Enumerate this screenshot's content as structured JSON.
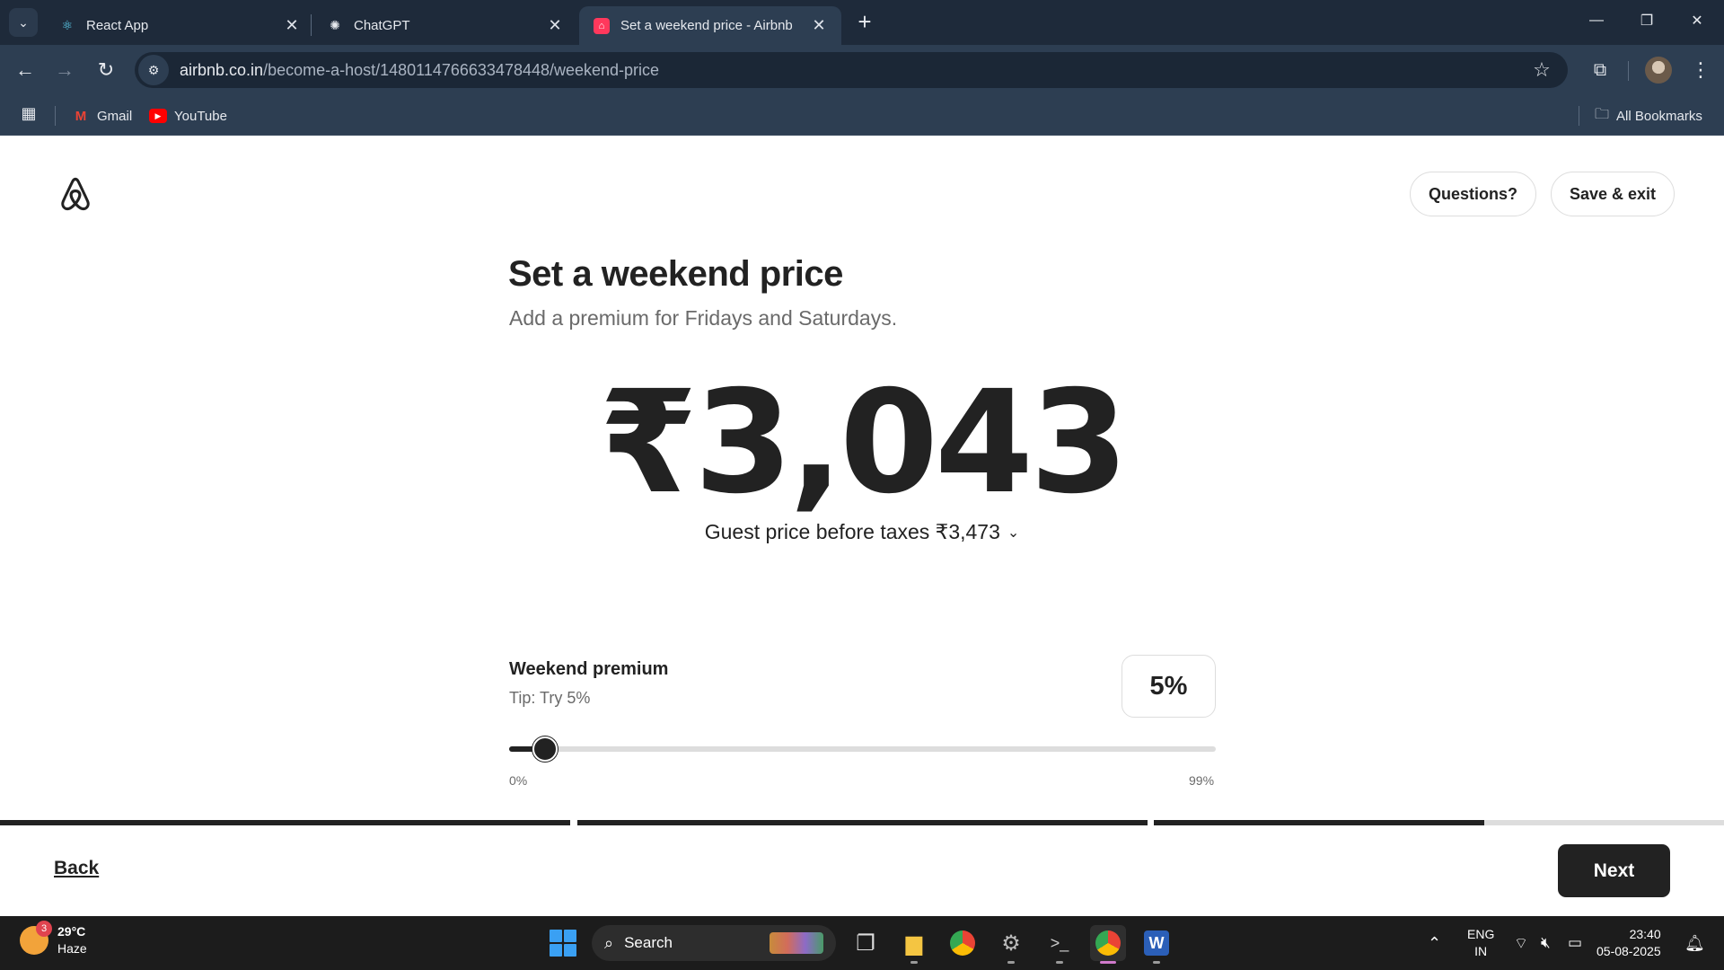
{
  "browser": {
    "tabs": [
      {
        "title": "React App",
        "icon": "react-icon"
      },
      {
        "title": "ChatGPT",
        "icon": "chatgpt-icon"
      },
      {
        "title": "Set a weekend price - Airbnb",
        "icon": "airbnb-icon",
        "active": true
      }
    ],
    "url_host": "airbnb.co.in",
    "url_path": "/become-a-host/1480114766633478448/weekend-price",
    "bookmarks": [
      {
        "label": "Gmail",
        "icon": "gmail-icon"
      },
      {
        "label": "YouTube",
        "icon": "youtube-icon"
      }
    ],
    "all_bookmarks": "All Bookmarks"
  },
  "header": {
    "questions_label": "Questions?",
    "save_exit_label": "Save & exit"
  },
  "main": {
    "title": "Set a weekend price",
    "subtitle": "Add a premium for Fridays and Saturdays.",
    "price": "₹3,043",
    "guest_price": "Guest price before taxes ₹3,473",
    "premium_label": "Weekend premium",
    "tip": "Tip: Try 5%",
    "premium_value": "5%",
    "slider": {
      "min_label": "0%",
      "max_label": "99%",
      "value": 5,
      "min": 0,
      "max": 99
    }
  },
  "progress": {
    "steps": [
      1,
      1,
      0.58
    ]
  },
  "footer": {
    "back_label": "Back",
    "next_label": "Next"
  },
  "taskbar": {
    "weather_temp": "29°C",
    "weather_desc": "Haze",
    "weather_badge": "3",
    "search_label": "Search",
    "lang_top": "ENG",
    "lang_bottom": "IN",
    "time": "23:40",
    "date": "05-08-2025"
  },
  "colors": {
    "airbnb_accent": "#ff385c",
    "text_primary": "#222222",
    "text_secondary": "#6a6a6a",
    "chrome_dark": "#1e2a3a"
  }
}
